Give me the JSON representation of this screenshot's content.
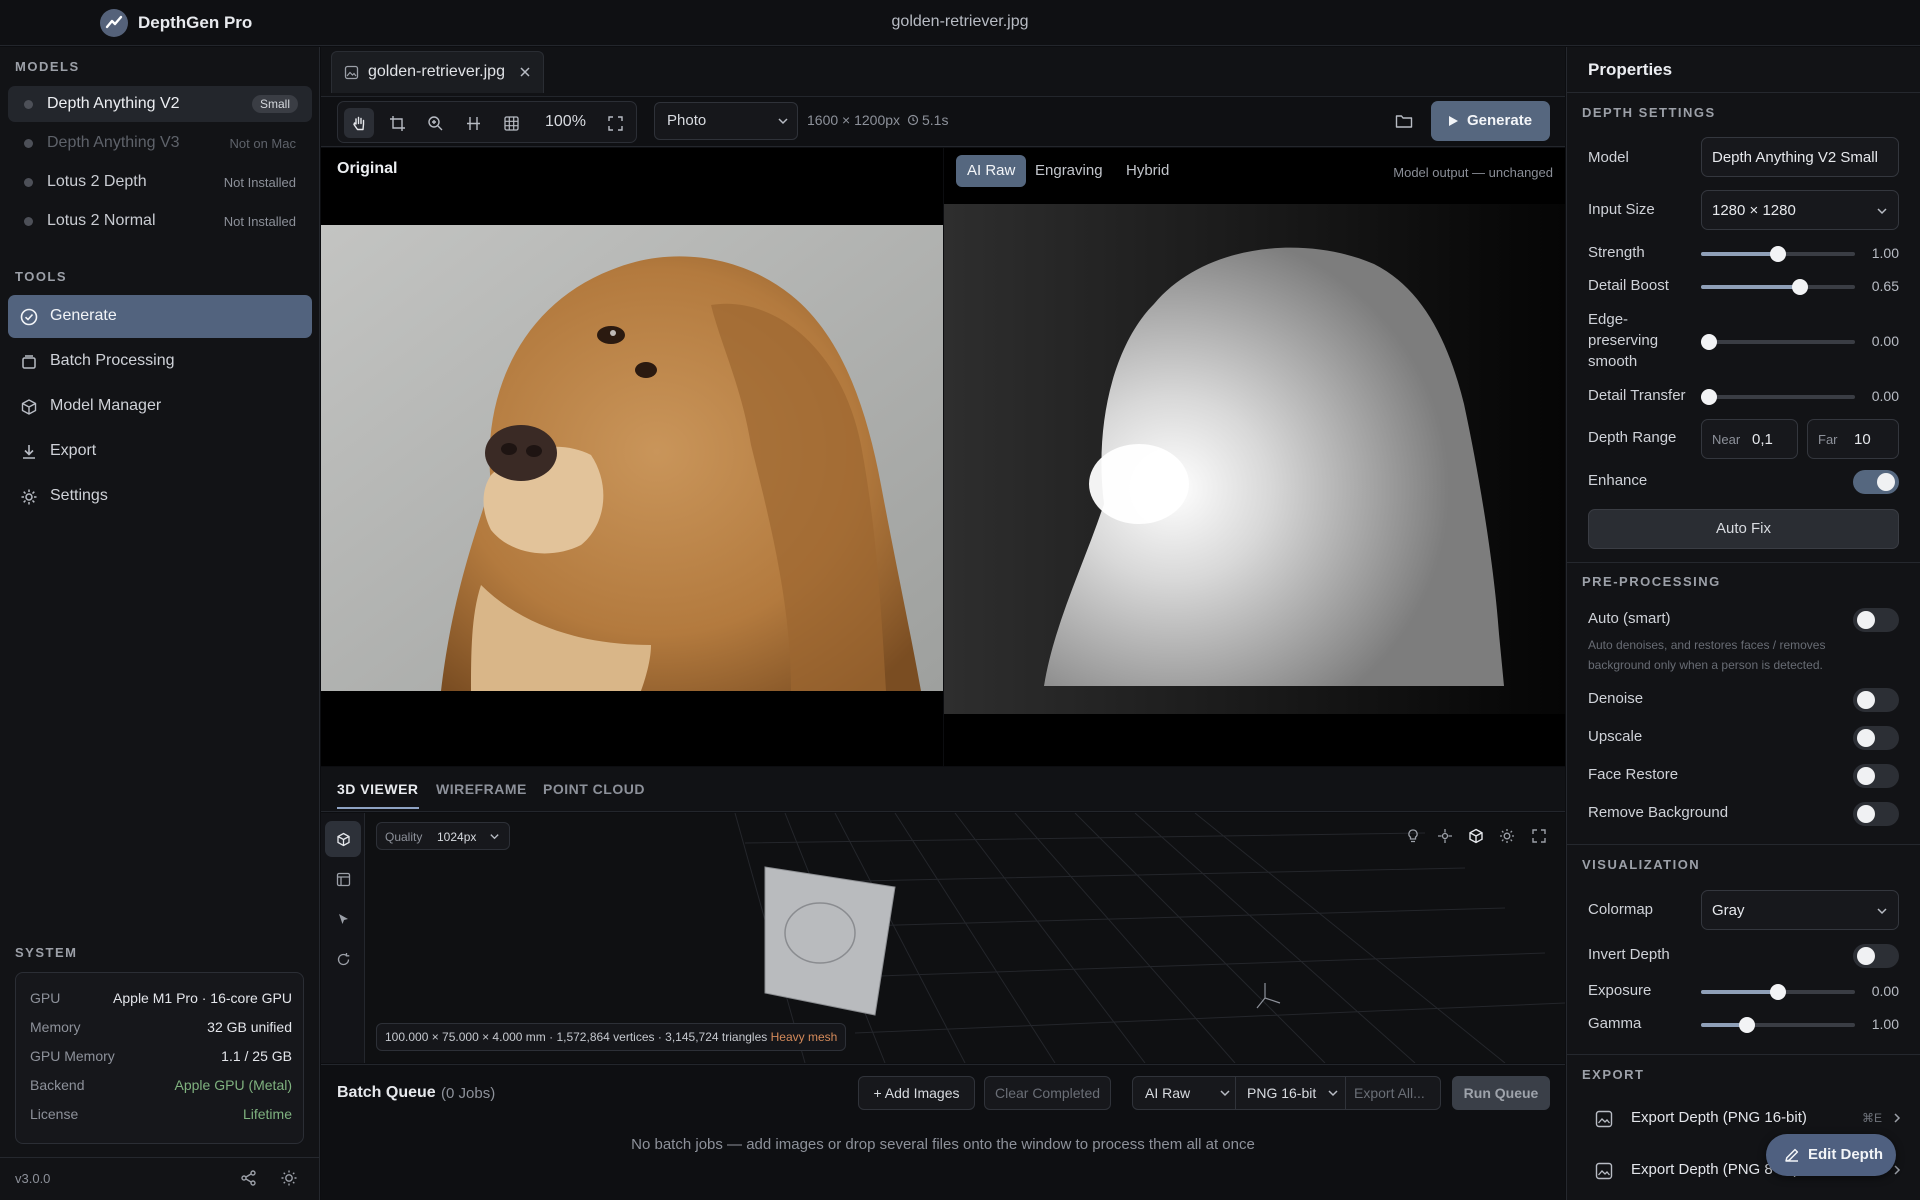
{
  "app": {
    "name": "DepthGen Pro",
    "window_title": "golden-retriever.jpg"
  },
  "sidebar": {
    "models_label": "MODELS",
    "models": [
      {
        "name": "Depth Anything V2",
        "status": "Small"
      },
      {
        "name": "Depth Anything V3",
        "status": "Not on Mac"
      },
      {
        "name": "Lotus 2 Depth",
        "status": "Not Installed"
      },
      {
        "name": "Lotus 2 Normal",
        "status": "Not Installed"
      }
    ],
    "tools_label": "TOOLS",
    "tools": [
      {
        "label": "Generate",
        "icon": "check-circle-icon"
      },
      {
        "label": "Batch Processing",
        "icon": "batch-icon"
      },
      {
        "label": "Model Manager",
        "icon": "cube-icon"
      },
      {
        "label": "Export",
        "icon": "download-icon"
      },
      {
        "label": "Settings",
        "icon": "gear-icon"
      }
    ],
    "system_label": "SYSTEM",
    "system": [
      {
        "key": "GPU",
        "value": "Apple M1 Pro · 16-core GPU"
      },
      {
        "key": "Memory",
        "value": "32 GB unified"
      },
      {
        "key": "GPU Memory",
        "value": "1.1 / 25 GB"
      },
      {
        "key": "Backend",
        "value": "Apple GPU (Metal)"
      },
      {
        "key": "License",
        "value": "Lifetime"
      }
    ],
    "version": "v3.0.0"
  },
  "editor": {
    "tab_name": "golden-retriever.jpg",
    "zoom": "100%",
    "preset": "Photo",
    "dimensions": "1600 × 1200px",
    "timing": "5.1s",
    "generate_label": "Generate",
    "original_label": "Original",
    "output_modes": [
      "AI Raw",
      "Engraving",
      "Hybrid"
    ],
    "output_note": "Model output — unchanged"
  },
  "viewer": {
    "tabs": [
      "3D VIEWER",
      "WIREFRAME",
      "POINT CLOUD"
    ],
    "quality_label": "Quality",
    "quality_value": "1024px",
    "mesh_info": "100.000 × 75.000 × 4.000 mm · 1,572,864 vertices · 3,145,724 triangles",
    "mesh_warning": "Heavy mesh"
  },
  "batch": {
    "title": "Batch Queue",
    "count": "(0 Jobs)",
    "add_label": "+ Add Images",
    "clear_label": "Clear Completed",
    "mode": "AI Raw",
    "format": "PNG 16-bit",
    "export_all": "Export All...",
    "run_label": "Run Queue",
    "empty_text": "No batch jobs — add images or drop several files onto the window to process them all at once"
  },
  "properties": {
    "title": "Properties",
    "depth_settings_label": "DEPTH SETTINGS",
    "model_label": "Model",
    "model_value": "Depth Anything V2 Small",
    "input_size_label": "Input Size",
    "input_size_value": "1280 × 1280",
    "sliders": [
      {
        "label": "Strength",
        "value": "1.00",
        "level": 0.5
      },
      {
        "label": "Detail Boost",
        "value": "0.65",
        "level": 0.64
      },
      {
        "label": "Edge-preserving smooth",
        "value": "0.00",
        "level": 0.05
      },
      {
        "label": "Detail Transfer",
        "value": "0.00",
        "level": 0.05
      }
    ],
    "depth_range_label": "Depth Range",
    "near_label": "Near",
    "near_value": "0,1",
    "far_label": "Far",
    "far_value": "10",
    "enhance_label": "Enhance",
    "enhance_on": true,
    "auto_fix_label": "Auto Fix",
    "preprocessing_label": "PRE-PROCESSING",
    "auto_smart_label": "Auto (smart)",
    "auto_smart_hint": "Auto denoises, and restores faces / removes background only when a person is detected.",
    "pre_toggles": [
      "Denoise",
      "Upscale",
      "Face Restore",
      "Remove Background"
    ],
    "visualization_label": "VISUALIZATION",
    "colormap_label": "Colormap",
    "colormap_value": "Gray",
    "invert_label": "Invert Depth",
    "exposure": {
      "label": "Exposure",
      "value": "0.00",
      "level": 0.5
    },
    "gamma": {
      "label": "Gamma",
      "value": "1.00",
      "level": 0.3
    },
    "export_label": "EXPORT",
    "exports": [
      {
        "label": "Export Depth (PNG 16-bit)",
        "shortcut": "⌘E"
      },
      {
        "label": "Export Depth (PNG 8-bit)",
        "shortcut": ""
      }
    ]
  },
  "fab_label": "Edit Depth"
}
